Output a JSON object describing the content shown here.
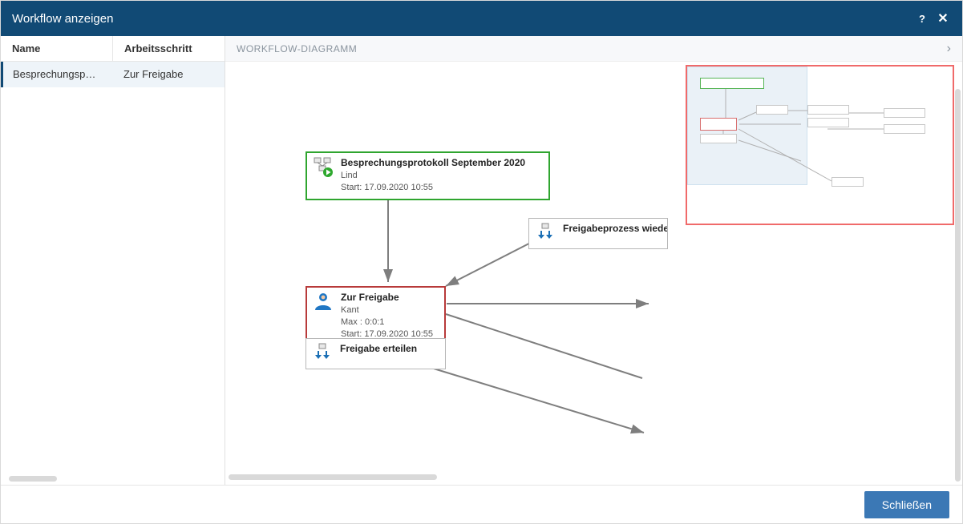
{
  "titlebar": {
    "title": "Workflow anzeigen",
    "help_icon": "?",
    "close_icon": "✕"
  },
  "sidebar": {
    "columns": {
      "name": "Name",
      "step": "Arbeitsschritt"
    },
    "rows": [
      {
        "name": "Besprechungsp…",
        "step": "Zur Freigabe"
      }
    ]
  },
  "section": {
    "title": "WORKFLOW-DIAGRAMM"
  },
  "nodes": {
    "start": {
      "title": "Besprechungsprotokoll September 2020",
      "user": "Lind",
      "started": "Start: 17.09.2020 10:55"
    },
    "repeat": {
      "title": "Freigabeprozess wiederholen"
    },
    "current": {
      "title": "Zur Freigabe",
      "user": "Kant",
      "max": "Max : 0:0:1",
      "started": "Start: 17.09.2020 10:55"
    },
    "approve": {
      "title": "Freigabe erteilen"
    }
  },
  "footer": {
    "close_button": "Schließen"
  }
}
